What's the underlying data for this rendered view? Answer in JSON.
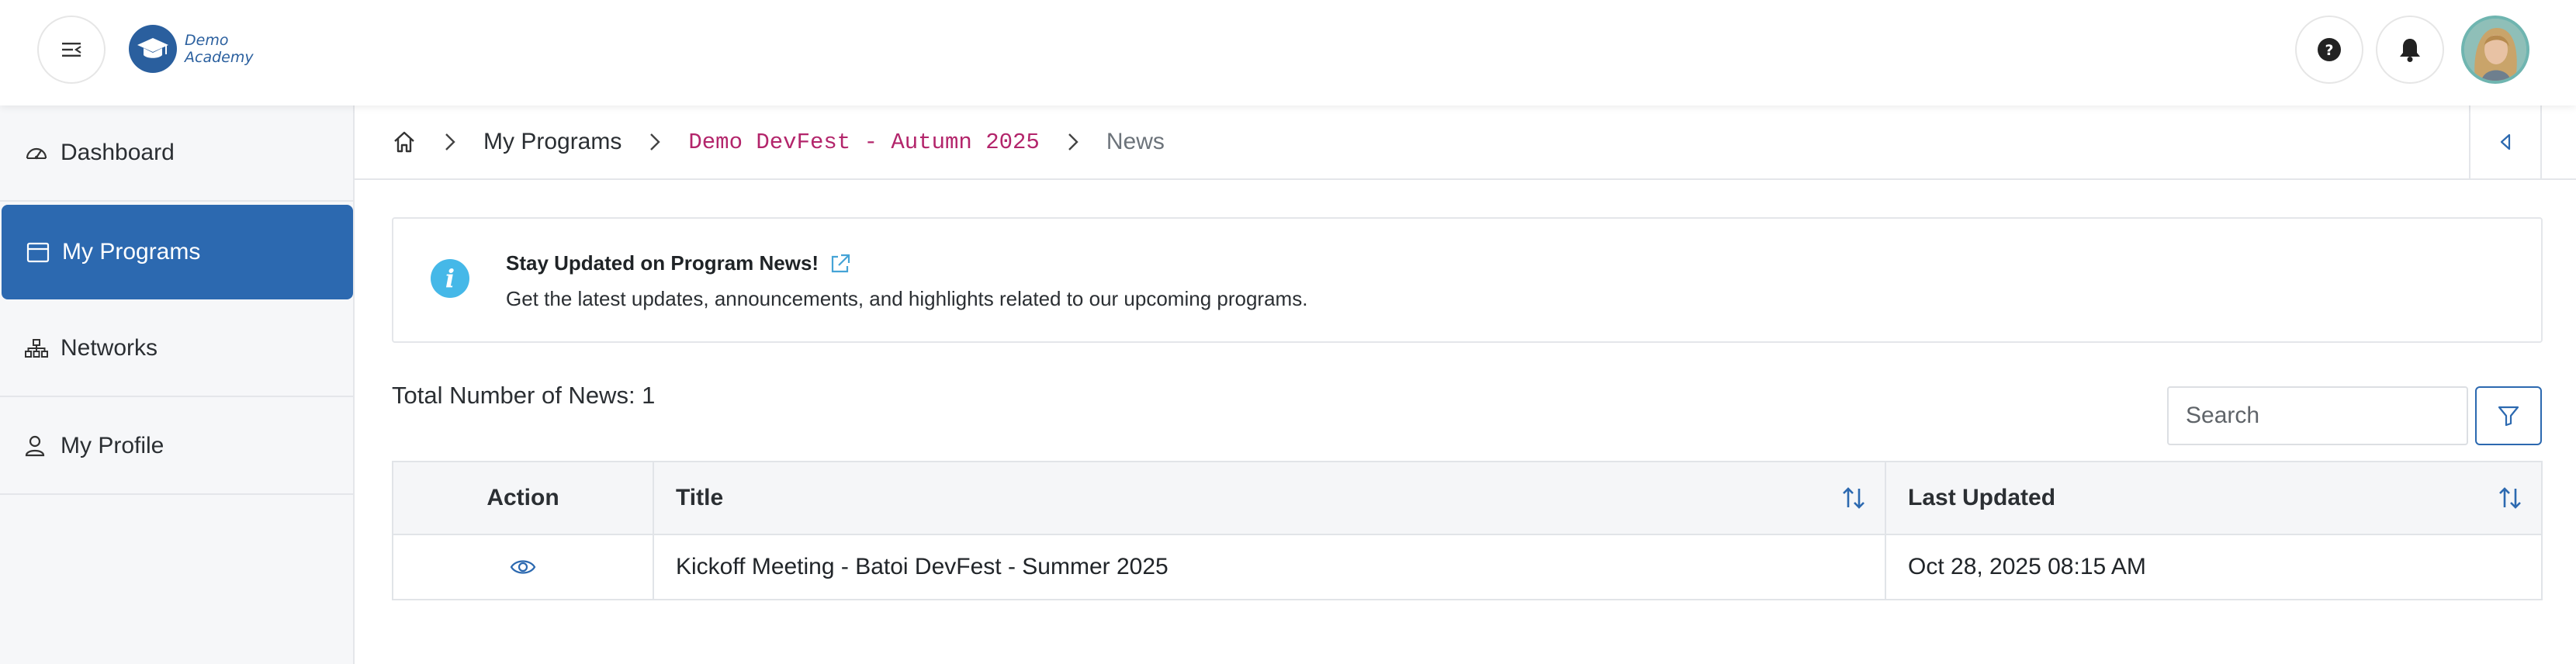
{
  "header": {
    "logo_line1": "Demo",
    "logo_line2": "Academy",
    "menu_icon": "menu-collapse-icon",
    "help_icon": "help-icon",
    "notification_icon": "bell-icon",
    "avatar": "user-avatar"
  },
  "sidebar": {
    "items": [
      {
        "label": "Dashboard",
        "icon": "gauge-icon",
        "active": false
      },
      {
        "label": "My Programs",
        "icon": "calendar-icon",
        "active": true
      },
      {
        "label": "Networks",
        "icon": "network-icon",
        "active": false
      },
      {
        "label": "My Profile",
        "icon": "user-icon",
        "active": false
      }
    ],
    "active_color": "#2c69b0"
  },
  "breadcrumb": {
    "home_icon": "home-icon",
    "items": [
      "My Programs",
      "Demo DevFest - Autumn 2025",
      "News"
    ]
  },
  "info": {
    "title": "Stay Updated on Program News!",
    "description": "Get the latest updates, announcements, and highlights related to our upcoming programs.",
    "icon": "info-icon",
    "link_icon": "external-link-icon"
  },
  "news": {
    "total_label": "Total Number of News: 1",
    "search_placeholder": "Search",
    "filter_icon": "filter-icon"
  },
  "table": {
    "columns": [
      "Action",
      "Title",
      "Last Updated"
    ],
    "rows": [
      {
        "action_icon": "eye-icon",
        "title": "Kickoff Meeting - Batoi DevFest - Summer 2025",
        "last_updated": "Oct 28, 2025 08:15 AM"
      }
    ]
  },
  "colors": {
    "accent": "#2c69b0",
    "program_crumb": "#b3256b",
    "info": "#45b8e8"
  }
}
